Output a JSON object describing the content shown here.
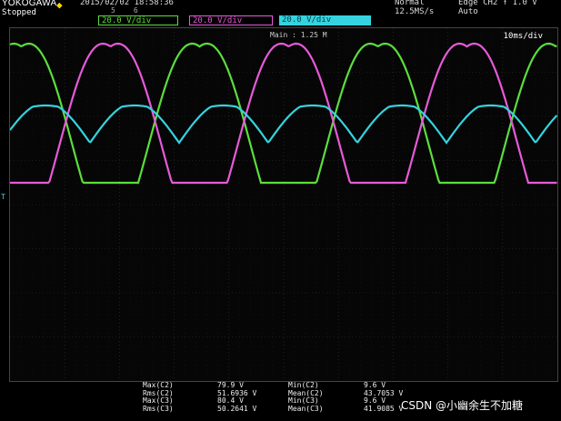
{
  "header": {
    "brand": "YOKOGAWA",
    "status": "Stopped",
    "datetime": "2015/02/02  18:58:36",
    "channel_nums": [
      "5",
      "6"
    ],
    "channels": [
      {
        "label": "20.0 V/div",
        "color": "#5bde3c"
      },
      {
        "label": "20.0 V/div",
        "color": "#e65ad8"
      },
      {
        "label": "20.0 V/div",
        "color": "#35d3df"
      }
    ],
    "mode_top": "Normal",
    "mode_bottom": "12.5MS/s",
    "trigger_top": "Edge CH2 ↑ 1.0 V",
    "trigger_bottom": "Auto"
  },
  "screen": {
    "timebase": "10ms/div",
    "memory": "Main : 1.25 M",
    "ch_marker": "T"
  },
  "measurements": {
    "col1_labels": [
      "Max(C2)",
      "Rms(C2)",
      "Max(C3)",
      "Rms(C3)"
    ],
    "col1_values": [
      "79.9 V",
      "51.6936 V",
      "80.4 V",
      "50.2641 V"
    ],
    "col2_labels": [
      "Min(C2)",
      "Mean(C2)",
      "Min(C3)",
      "Mean(C3)"
    ],
    "col2_values": [
      "9.6 V",
      "43.7053 V",
      "9.6 V",
      "41.9085 V"
    ]
  },
  "watermark": "CSDN @小幽余生不加糖",
  "traces": {
    "green": "#5bde3c",
    "magenta": "#e65ad8",
    "cyan": "#35d3df"
  }
}
